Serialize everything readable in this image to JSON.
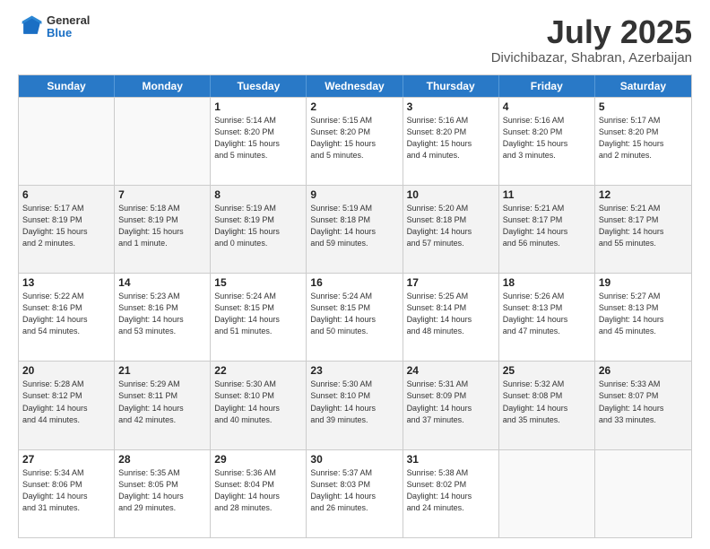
{
  "logo": {
    "general": "General",
    "blue": "Blue"
  },
  "header": {
    "title": "July 2025",
    "subtitle": "Divichibazar, Shabran, Azerbaijan"
  },
  "weekdays": [
    "Sunday",
    "Monday",
    "Tuesday",
    "Wednesday",
    "Thursday",
    "Friday",
    "Saturday"
  ],
  "weeks": [
    [
      {
        "day": "",
        "info": ""
      },
      {
        "day": "",
        "info": ""
      },
      {
        "day": "1",
        "info": "Sunrise: 5:14 AM\nSunset: 8:20 PM\nDaylight: 15 hours\nand 5 minutes."
      },
      {
        "day": "2",
        "info": "Sunrise: 5:15 AM\nSunset: 8:20 PM\nDaylight: 15 hours\nand 5 minutes."
      },
      {
        "day": "3",
        "info": "Sunrise: 5:16 AM\nSunset: 8:20 PM\nDaylight: 15 hours\nand 4 minutes."
      },
      {
        "day": "4",
        "info": "Sunrise: 5:16 AM\nSunset: 8:20 PM\nDaylight: 15 hours\nand 3 minutes."
      },
      {
        "day": "5",
        "info": "Sunrise: 5:17 AM\nSunset: 8:20 PM\nDaylight: 15 hours\nand 2 minutes."
      }
    ],
    [
      {
        "day": "6",
        "info": "Sunrise: 5:17 AM\nSunset: 8:19 PM\nDaylight: 15 hours\nand 2 minutes."
      },
      {
        "day": "7",
        "info": "Sunrise: 5:18 AM\nSunset: 8:19 PM\nDaylight: 15 hours\nand 1 minute."
      },
      {
        "day": "8",
        "info": "Sunrise: 5:19 AM\nSunset: 8:19 PM\nDaylight: 15 hours\nand 0 minutes."
      },
      {
        "day": "9",
        "info": "Sunrise: 5:19 AM\nSunset: 8:18 PM\nDaylight: 14 hours\nand 59 minutes."
      },
      {
        "day": "10",
        "info": "Sunrise: 5:20 AM\nSunset: 8:18 PM\nDaylight: 14 hours\nand 57 minutes."
      },
      {
        "day": "11",
        "info": "Sunrise: 5:21 AM\nSunset: 8:17 PM\nDaylight: 14 hours\nand 56 minutes."
      },
      {
        "day": "12",
        "info": "Sunrise: 5:21 AM\nSunset: 8:17 PM\nDaylight: 14 hours\nand 55 minutes."
      }
    ],
    [
      {
        "day": "13",
        "info": "Sunrise: 5:22 AM\nSunset: 8:16 PM\nDaylight: 14 hours\nand 54 minutes."
      },
      {
        "day": "14",
        "info": "Sunrise: 5:23 AM\nSunset: 8:16 PM\nDaylight: 14 hours\nand 53 minutes."
      },
      {
        "day": "15",
        "info": "Sunrise: 5:24 AM\nSunset: 8:15 PM\nDaylight: 14 hours\nand 51 minutes."
      },
      {
        "day": "16",
        "info": "Sunrise: 5:24 AM\nSunset: 8:15 PM\nDaylight: 14 hours\nand 50 minutes."
      },
      {
        "day": "17",
        "info": "Sunrise: 5:25 AM\nSunset: 8:14 PM\nDaylight: 14 hours\nand 48 minutes."
      },
      {
        "day": "18",
        "info": "Sunrise: 5:26 AM\nSunset: 8:13 PM\nDaylight: 14 hours\nand 47 minutes."
      },
      {
        "day": "19",
        "info": "Sunrise: 5:27 AM\nSunset: 8:13 PM\nDaylight: 14 hours\nand 45 minutes."
      }
    ],
    [
      {
        "day": "20",
        "info": "Sunrise: 5:28 AM\nSunset: 8:12 PM\nDaylight: 14 hours\nand 44 minutes."
      },
      {
        "day": "21",
        "info": "Sunrise: 5:29 AM\nSunset: 8:11 PM\nDaylight: 14 hours\nand 42 minutes."
      },
      {
        "day": "22",
        "info": "Sunrise: 5:30 AM\nSunset: 8:10 PM\nDaylight: 14 hours\nand 40 minutes."
      },
      {
        "day": "23",
        "info": "Sunrise: 5:30 AM\nSunset: 8:10 PM\nDaylight: 14 hours\nand 39 minutes."
      },
      {
        "day": "24",
        "info": "Sunrise: 5:31 AM\nSunset: 8:09 PM\nDaylight: 14 hours\nand 37 minutes."
      },
      {
        "day": "25",
        "info": "Sunrise: 5:32 AM\nSunset: 8:08 PM\nDaylight: 14 hours\nand 35 minutes."
      },
      {
        "day": "26",
        "info": "Sunrise: 5:33 AM\nSunset: 8:07 PM\nDaylight: 14 hours\nand 33 minutes."
      }
    ],
    [
      {
        "day": "27",
        "info": "Sunrise: 5:34 AM\nSunset: 8:06 PM\nDaylight: 14 hours\nand 31 minutes."
      },
      {
        "day": "28",
        "info": "Sunrise: 5:35 AM\nSunset: 8:05 PM\nDaylight: 14 hours\nand 29 minutes."
      },
      {
        "day": "29",
        "info": "Sunrise: 5:36 AM\nSunset: 8:04 PM\nDaylight: 14 hours\nand 28 minutes."
      },
      {
        "day": "30",
        "info": "Sunrise: 5:37 AM\nSunset: 8:03 PM\nDaylight: 14 hours\nand 26 minutes."
      },
      {
        "day": "31",
        "info": "Sunrise: 5:38 AM\nSunset: 8:02 PM\nDaylight: 14 hours\nand 24 minutes."
      },
      {
        "day": "",
        "info": ""
      },
      {
        "day": "",
        "info": ""
      }
    ]
  ]
}
